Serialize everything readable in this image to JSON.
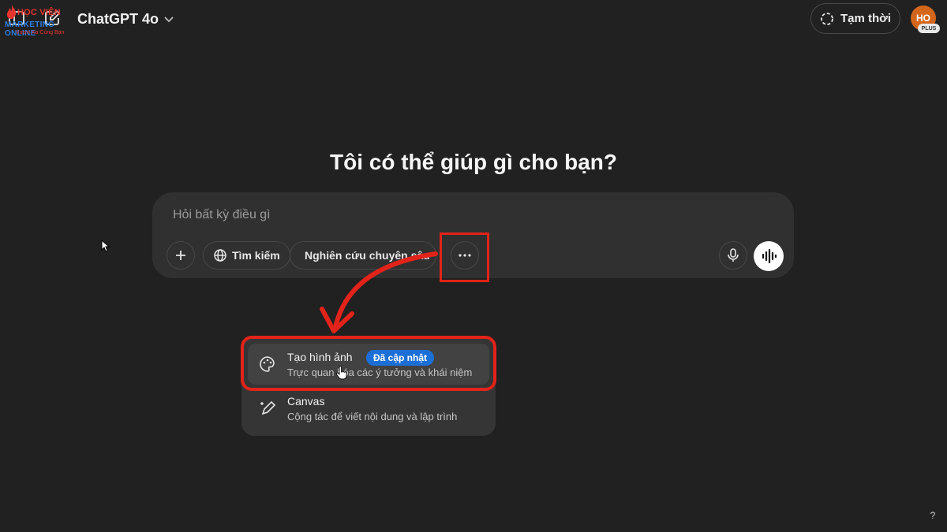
{
  "header": {
    "model_label": "ChatGPT 4o",
    "temp_label": "Tạm thời",
    "avatar_initials": "HO",
    "plan_badge": "PLUS"
  },
  "watermark": {
    "line1": "HỌC VIỆN",
    "line2": "MARKETING ONLINE",
    "line3": "Vươn Xa Cùng Bạn"
  },
  "main": {
    "heading": "Tôi có thể giúp gì cho bạn?"
  },
  "composer": {
    "placeholder": "Hỏi bất kỳ điều gì",
    "search_label": "Tìm kiếm",
    "research_label": "Nghiên cứu chuyên sâu",
    "more_label": "···"
  },
  "menu": {
    "items": [
      {
        "title": "Tạo hình ảnh",
        "badge": "Đã cập nhật",
        "desc": "Trực quan hóa các ý tưởng và khái niệm",
        "icon": "palette-icon"
      },
      {
        "title": "Canvas",
        "desc": "Cộng tác để viết nội dung và lập trình",
        "icon": "pen-sparkle-icon"
      }
    ]
  },
  "footer": {
    "help": "?"
  },
  "colors": {
    "background": "#212121",
    "composer": "#303030",
    "accent_red": "#e2231a",
    "badge_blue": "#1c6fd6"
  }
}
